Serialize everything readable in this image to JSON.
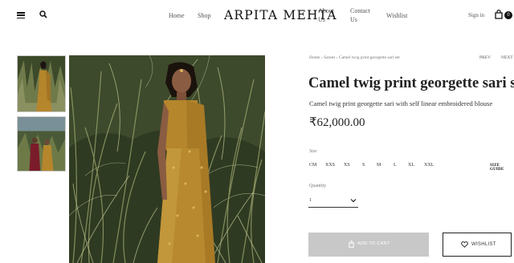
{
  "header": {
    "logo": "ARPITA MEHTA",
    "nav": {
      "home": "Home",
      "shop": "Shop",
      "about_l1": "About",
      "about_l2": "Us",
      "contact_l1": "Contact",
      "contact_l2": "Us",
      "wishlist": "Wishlist"
    },
    "sign_in": "Sign in",
    "cart_count": "0",
    "icons": [
      "menu-icon",
      "search-icon",
      "shopping-bag-icon"
    ]
  },
  "breadcrumb": {
    "home": "Home",
    "category": "Sarees",
    "current": "Camel twig print georgette sari set",
    "separator": "›"
  },
  "pager": {
    "prev": "PREV",
    "next": "NEXT"
  },
  "product": {
    "title": "Camel twig print georgette sari set",
    "subtitle": "Camel twig print georgette sari with self linear embroidered blouse",
    "price": "₹62,000.00",
    "size_label": "Size",
    "sizes": [
      "CM",
      "XXS",
      "XS",
      "S",
      "M",
      "L",
      "XL",
      "XXL"
    ],
    "size_guide": "SIZE GUIDE",
    "quantity_label": "Quantity",
    "quantity_value": "1",
    "add_to_cart": "ADD TO CART",
    "wishlist_button": "WISHLIST"
  },
  "colors": {
    "button_disabled": "#c8c8c8",
    "text": "#222222",
    "sari": "#b5862c"
  }
}
